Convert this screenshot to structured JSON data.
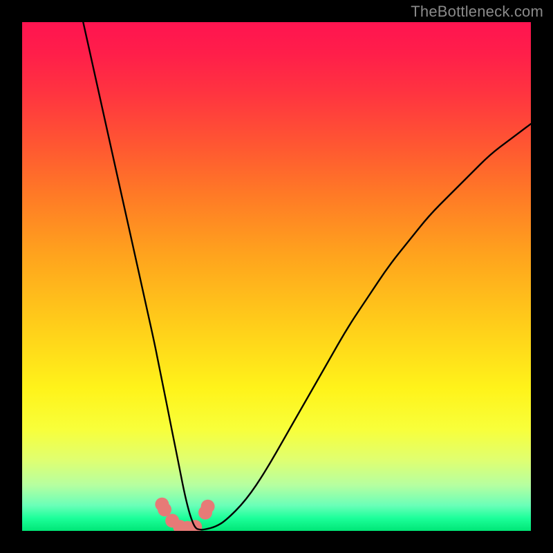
{
  "watermark": {
    "label": "TheBottleneck.com"
  },
  "chart_data": {
    "type": "line",
    "title": "",
    "xlabel": "",
    "ylabel": "",
    "xlim": [
      0,
      100
    ],
    "ylim": [
      0,
      100
    ],
    "series": [
      {
        "name": "curve",
        "x": [
          12,
          14,
          16,
          18,
          20,
          22,
          24,
          26,
          27,
          28,
          29,
          30,
          31,
          32,
          33,
          34,
          35,
          36,
          38,
          40,
          44,
          48,
          52,
          56,
          60,
          64,
          68,
          72,
          76,
          80,
          84,
          88,
          92,
          96,
          100
        ],
        "values": [
          100,
          91,
          82,
          73,
          64,
          55,
          46,
          37,
          32,
          27,
          22,
          17,
          12,
          7,
          3,
          0.5,
          0.2,
          0.3,
          0.8,
          2,
          6,
          12,
          19,
          26,
          33,
          40,
          46,
          52,
          57,
          62,
          66,
          70,
          74,
          77,
          80
        ]
      }
    ],
    "markers": {
      "name": "highlight-points",
      "x": [
        27.5,
        28.0,
        29.5,
        31.0,
        32.5,
        34.0,
        36.0,
        36.5
      ],
      "values": [
        5.2,
        4.2,
        2.0,
        0.8,
        0.6,
        0.8,
        3.6,
        4.8
      ],
      "color": "#e77a77",
      "radius_px": 10
    },
    "background_gradient": {
      "orientation": "vertical",
      "stops": [
        {
          "pos": 0.0,
          "color": "#ff1450"
        },
        {
          "pos": 0.5,
          "color": "#ffb81d"
        },
        {
          "pos": 0.78,
          "color": "#fff31a"
        },
        {
          "pos": 1.0,
          "color": "#00e676"
        }
      ]
    }
  }
}
